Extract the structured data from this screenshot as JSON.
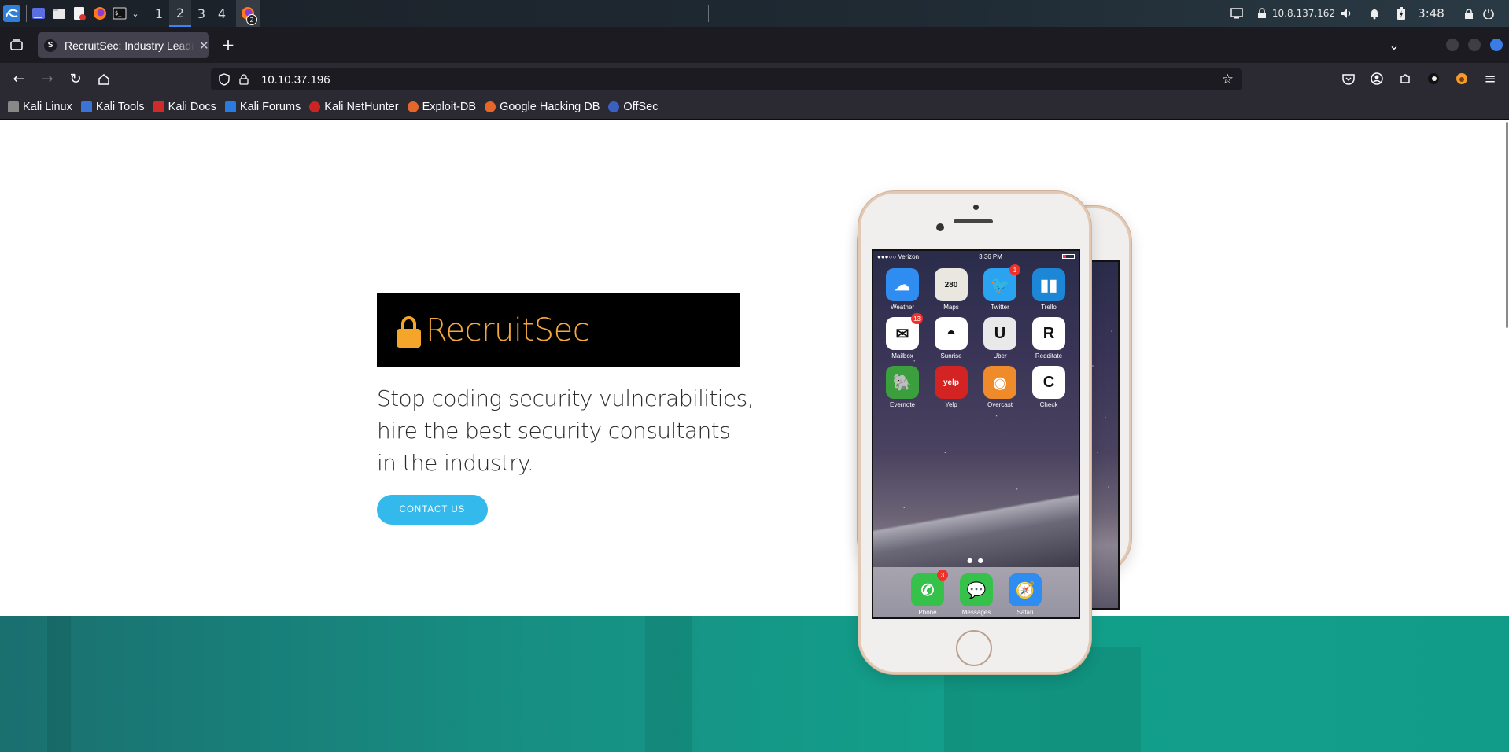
{
  "panel": {
    "workspaces": [
      "1",
      "2",
      "3",
      "4"
    ],
    "active_workspace": "2",
    "browser_badge": "2",
    "ip": "10.8.137.162",
    "time": "3:48"
  },
  "browser": {
    "tab_title": "RecruitSec: Industry Leading",
    "tab_favicon_letter": "S",
    "url": "10.10.37.196"
  },
  "bookmarks": [
    {
      "label": "Kali Linux",
      "color": "#2b2a33"
    },
    {
      "label": "Kali Tools",
      "color": "#3b73d6"
    },
    {
      "label": "Kali Docs",
      "color": "#d02b2b"
    },
    {
      "label": "Kali Forums",
      "color": "#2a7be0"
    },
    {
      "label": "Kali NetHunter",
      "color": "#c92525"
    },
    {
      "label": "Exploit-DB",
      "color": "#e4662a"
    },
    {
      "label": "Google Hacking DB",
      "color": "#e4662a"
    },
    {
      "label": "OffSec",
      "color": "#3c5fc2"
    }
  ],
  "hero": {
    "brand": "RecruitSec",
    "tagline": "Stop coding security vulnerabilities, hire the best security consultants in the industry.",
    "cta_label": "CONTACT US"
  },
  "phone": {
    "carrier": "●●●○○ Verizon",
    "time": "3:36 PM",
    "apps": [
      {
        "label": "Weather",
        "glyph": "☁",
        "bg": "#2f8cf0",
        "badge": ""
      },
      {
        "label": "Maps",
        "glyph": "280",
        "bg": "#e9e7df",
        "badge": ""
      },
      {
        "label": "Twitter",
        "glyph": "🐦",
        "bg": "#2aa3f0",
        "badge": "1"
      },
      {
        "label": "Trello",
        "glyph": "▮▮",
        "bg": "#1b87d6",
        "badge": ""
      },
      {
        "label": "Mailbox",
        "glyph": "✉",
        "bg": "#ffffff",
        "badge": "13"
      },
      {
        "label": "Sunrise",
        "glyph": "◓",
        "bg": "#ffffff",
        "badge": ""
      },
      {
        "label": "Uber",
        "glyph": "U",
        "bg": "#e9e9e9",
        "badge": ""
      },
      {
        "label": "Redditate",
        "glyph": "R",
        "bg": "#ffffff",
        "badge": ""
      },
      {
        "label": "Evernote",
        "glyph": "🐘",
        "bg": "#3a9f3c",
        "badge": ""
      },
      {
        "label": "Yelp",
        "glyph": "yelp",
        "bg": "#d32323",
        "badge": ""
      },
      {
        "label": "Overcast",
        "glyph": "◉",
        "bg": "#f08b2b",
        "badge": ""
      },
      {
        "label": "Check",
        "glyph": "C",
        "bg": "#ffffff",
        "badge": ""
      }
    ],
    "dock": [
      {
        "label": "Phone",
        "glyph": "✆",
        "bg": "#35c14a",
        "badge": "3"
      },
      {
        "label": "Messages",
        "glyph": "💬",
        "bg": "#35c14a",
        "badge": ""
      },
      {
        "label": "Safari",
        "glyph": "🧭",
        "bg": "#2f8cf0",
        "badge": ""
      }
    ]
  }
}
